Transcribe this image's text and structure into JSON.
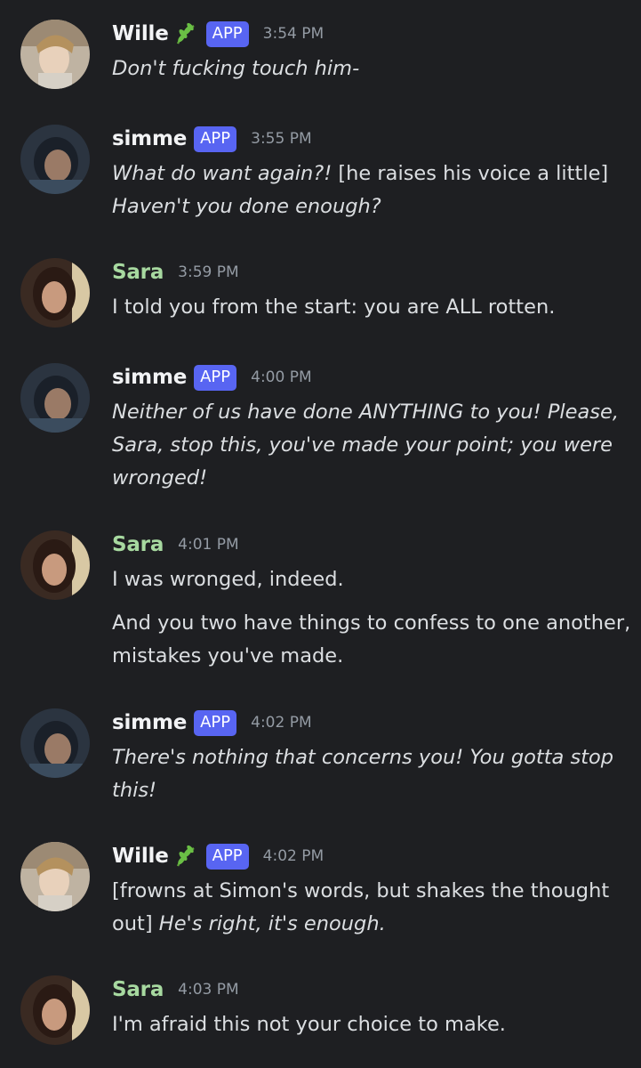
{
  "messages": [
    {
      "author": "Wille",
      "author_emoji": "leaf-icon",
      "badge": "APP",
      "time": "3:54 PM",
      "lines": [
        [
          {
            "text": "Don't fucking touch him-",
            "italic": true
          }
        ]
      ]
    },
    {
      "author": "simme",
      "badge": "APP",
      "time": "3:55 PM",
      "lines": [
        [
          {
            "text": "What do want again?!",
            "italic": true
          },
          {
            "text": " [he raises his voice a little]",
            "italic": false
          }
        ],
        [
          {
            "text": "Haven't you done enough?",
            "italic": true
          }
        ]
      ]
    },
    {
      "author": "Sara",
      "time": "3:59 PM",
      "lines": [
        [
          {
            "text": "I told you from the start: you are ALL rotten.",
            "italic": false
          }
        ]
      ]
    },
    {
      "author": "simme",
      "badge": "APP",
      "time": "4:00 PM",
      "lines": [
        [
          {
            "text": "Neither of us have done ANYTHING to you! Please,",
            "italic": true
          }
        ],
        [
          {
            "text": "Sara, stop this, you've made your point; you were",
            "italic": true
          }
        ],
        [
          {
            "text": "wronged!",
            "italic": true
          }
        ]
      ]
    },
    {
      "author": "Sara",
      "time": "4:01 PM",
      "lines": [
        [
          {
            "text": "I was wronged, indeed.",
            "italic": false
          }
        ]
      ],
      "lines2": [
        [
          {
            "text": "And you two have things to confess to one another,",
            "italic": false
          }
        ],
        [
          {
            "text": "mistakes you've made.",
            "italic": false
          }
        ]
      ]
    },
    {
      "author": "simme",
      "badge": "APP",
      "time": "4:02 PM",
      "lines": [
        [
          {
            "text": "There's nothing that concerns you! You gotta stop",
            "italic": true
          }
        ],
        [
          {
            "text": "this!",
            "italic": true
          }
        ]
      ]
    },
    {
      "author": "Wille",
      "author_emoji": "leaf-icon",
      "badge": "APP",
      "time": "4:02 PM",
      "lines": [
        [
          {
            "text": "[frowns at Simon's words, but shakes the thought",
            "italic": false
          }
        ],
        [
          {
            "text": "out] ",
            "italic": false
          },
          {
            "text": "He's right, it's enough.",
            "italic": true
          }
        ]
      ]
    },
    {
      "author": "Sara",
      "time": "4:03 PM",
      "lines": [
        [
          {
            "text": "I'm afraid this not your choice to make.",
            "italic": false
          }
        ]
      ]
    }
  ],
  "colors": {
    "background": "#1e1f22",
    "text": "#dbdee1",
    "name": "#f2f3f5",
    "sara_name": "#a7d9a0",
    "badge": "#5865f2",
    "timestamp": "#949ba4"
  }
}
